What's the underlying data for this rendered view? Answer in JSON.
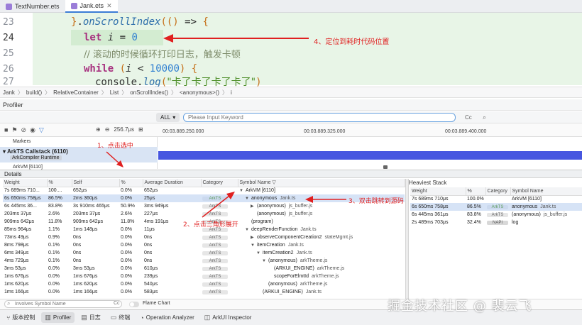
{
  "tabs": [
    {
      "label": "TextNumber.ets"
    },
    {
      "label": "Jank.ets"
    }
  ],
  "editor": {
    "lines": [
      {
        "num": "23",
        "code": "}.onScrollIndex(() => {"
      },
      {
        "num": "24",
        "code": "let i = 0"
      },
      {
        "num": "25",
        "code": "// 滚动的时候循环打印日志，触发卡顿"
      },
      {
        "num": "26",
        "code": "while (i < 10000) {"
      },
      {
        "num": "27",
        "code": "console.log(\"卡了卡了卡了卡了\")"
      }
    ],
    "annotation": "4、定位到耗时代码位置"
  },
  "breadcrumb": [
    "Jank",
    "build()",
    "RelativeContainer",
    "List",
    "onScrollIndex()",
    "<anonymous>()",
    "i"
  ],
  "profiler": {
    "title": "Profiler",
    "filter_all": "ALL",
    "search_placeholder": "Please Input Keyword",
    "cc": "Cc",
    "zoom_value": "256.7μs",
    "ticks": [
      "00:03.889.250.000",
      "00:03.889.325.000",
      "00:03.889.400.000"
    ],
    "lane_markers": "Markers",
    "lane_callstack": "ArkTS Callstack (6110)",
    "lane_badge": "ArkCompiler Runtime",
    "lane_arkvm": "ArkVM [6110]",
    "annotation_select": "1、点击选中",
    "annotation_expand": "2、点击三角形展开",
    "annotation_jump": "3、双击跳转到源码"
  },
  "details": {
    "title": "Details",
    "columns": [
      "Weight",
      "%",
      "Self",
      "%",
      "Average Duration",
      "Category",
      "Symbol Name"
    ],
    "rows": [
      {
        "weight": "7s 689ms 710...",
        "wp": "100....",
        "self": "652μs",
        "sp": "0.0%",
        "avg": "652μs",
        "cat": "",
        "indent": 0,
        "tri": "▼",
        "sym": "ArkVM [6110]",
        "file": ""
      },
      {
        "weight": "6s 650ms 758μs",
        "wp": "86.5%",
        "self": "2ms 360μs",
        "sp": "0.0%",
        "avg": "25μs",
        "cat": "ArkTS",
        "indent": 1,
        "tri": "▼",
        "sym": "anonymous",
        "file": "Jank.ts"
      },
      {
        "weight": "6s 445ms 36...",
        "wp": "83.8%",
        "self": "3s 910ms 465μs",
        "sp": "50.9%",
        "avg": "3ms 949μs",
        "cat": "ArkTS",
        "indent": 2,
        "tri": "▶",
        "sym": "(anonymous)",
        "file": "js_buffer.js"
      },
      {
        "weight": "203ms 37μs",
        "wp": "2.6%",
        "self": "203ms 37μs",
        "sp": "2.6%",
        "avg": "227μs",
        "cat": "ArkTS",
        "indent": 2,
        "tri": "",
        "sym": "(anonymous)",
        "file": "js_buffer.js"
      },
      {
        "weight": "909ms 642μs",
        "wp": "11.8%",
        "self": "909ms 642μs",
        "sp": "11.8%",
        "avg": "4ms 191μs",
        "cat": "ArkTS",
        "indent": 1,
        "tri": "",
        "sym": "(program)",
        "file": ""
      },
      {
        "weight": "85ms 964μs",
        "wp": "1.1%",
        "self": "1ms 148μs",
        "sp": "0.0%",
        "avg": "11μs",
        "cat": "ArkTS",
        "indent": 1,
        "tri": "▼",
        "sym": "deepRenderFunction",
        "file": "Jank.ts"
      },
      {
        "weight": "73ms 49μs",
        "wp": "0.9%",
        "self": "0ns",
        "sp": "0.0%",
        "avg": "0ns",
        "cat": "ArkTS",
        "indent": 2,
        "tri": "▶",
        "sym": "observeComponentCreation2",
        "file": "stateMgmt.js"
      },
      {
        "weight": "8ms 798μs",
        "wp": "0.1%",
        "self": "0ns",
        "sp": "0.0%",
        "avg": "0ns",
        "cat": "ArkTS",
        "indent": 2,
        "tri": "▼",
        "sym": "itemCreation",
        "file": "Jank.ts"
      },
      {
        "weight": "6ms 349μs",
        "wp": "0.1%",
        "self": "0ns",
        "sp": "0.0%",
        "avg": "0ns",
        "cat": "ArkTS",
        "indent": 3,
        "tri": "▼",
        "sym": "itemCreation2",
        "file": "Jank.ts"
      },
      {
        "weight": "4ms 729μs",
        "wp": "0.1%",
        "self": "0ns",
        "sp": "0.0%",
        "avg": "0ns",
        "cat": "ArkTS",
        "indent": 4,
        "tri": "▼",
        "sym": "(anonymous)",
        "file": "arkTheme.js"
      },
      {
        "weight": "3ms 53μs",
        "wp": "0.0%",
        "self": "3ms 53μs",
        "sp": "0.0%",
        "avg": "610μs",
        "cat": "ArkTS",
        "indent": 5,
        "tri": "",
        "sym": "(ARKUI_ENGINE)",
        "file": "arkTheme.js"
      },
      {
        "weight": "1ms 676μs",
        "wp": "0.0%",
        "self": "1ms 676μs",
        "sp": "0.0%",
        "avg": "239μs",
        "cat": "ArkTS",
        "indent": 5,
        "tri": "",
        "sym": "scopeForElmtId",
        "file": "arkTheme.js"
      },
      {
        "weight": "1ms 620μs",
        "wp": "0.0%",
        "self": "1ms 620μs",
        "sp": "0.0%",
        "avg": "540μs",
        "cat": "ArkTS",
        "indent": 4,
        "tri": "",
        "sym": "(anonymous)",
        "file": "arkTheme.js"
      },
      {
        "weight": "1ms 166μs",
        "wp": "0.0%",
        "self": "1ms 166μs",
        "sp": "0.0%",
        "avg": "583μs",
        "cat": "ArkTS",
        "indent": 3,
        "tri": "",
        "sym": "(ARKUI_ENGINE)",
        "file": "Jank.ts"
      }
    ]
  },
  "heaviest": {
    "title": "Heaviest Stack",
    "columns": [
      "Weight",
      "%",
      "Category",
      "Symbol Name"
    ],
    "rows": [
      {
        "weight": "7s 689ms 710μs",
        "pct": "100.0%",
        "cat": "",
        "sym": "ArkVM [6110]",
        "file": ""
      },
      {
        "weight": "6s 650ms 758μs",
        "pct": "86.5%",
        "cat": "ArkTS",
        "sym": "anonymous",
        "file": "Jank.ts"
      },
      {
        "weight": "6s 445ms 361μs",
        "pct": "83.8%",
        "cat": "ArkTS",
        "sym": "(anonymous)",
        "file": "js_buffer.js"
      },
      {
        "weight": "2s 489ms 703μs",
        "pct": "32.4%",
        "cat": "NAPI",
        "sym": "log",
        "file": ""
      }
    ]
  },
  "bottom": {
    "search_placeholder": "Involves Symbol Name",
    "cc": "Cc",
    "flame_label": "Flame Chart"
  },
  "statusbar": [
    {
      "label": "版本控制",
      "icon": "branch-icon"
    },
    {
      "label": "Profiler",
      "icon": "profiler-icon"
    },
    {
      "label": "日志",
      "icon": "log-icon"
    },
    {
      "label": "终端",
      "icon": "terminal-icon"
    },
    {
      "label": "Operation Analyzer",
      "icon": "analyzer-icon"
    },
    {
      "label": "ArkUI Inspector",
      "icon": "inspector-icon"
    }
  ],
  "watermark": "掘金技术社区 @ 裴云飞",
  "colors": {
    "accent": "#3a7bd5",
    "annotation": "#e02020",
    "track": "#4656e0",
    "selected_row": "#d6e3f6"
  }
}
